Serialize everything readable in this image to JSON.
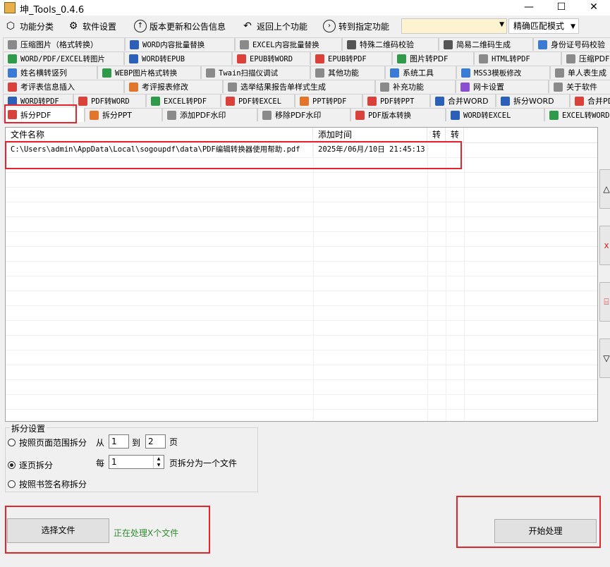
{
  "window": {
    "title": "坤_Tools_0.4.6",
    "minimize": "—",
    "maximize": "☐",
    "close": "✕"
  },
  "toolbar": {
    "categories": "功能分类",
    "settings": "软件设置",
    "updates": "版本更新和公告信息",
    "back": "返回上个功能",
    "goto": "转到指定功能",
    "mode": "精确匹配模式"
  },
  "tab_rows": [
    [
      {
        "label": "压缩图片（格式转换）",
        "icon": "gray"
      },
      {
        "label": "WORD内容批量替换",
        "icon": "word"
      },
      {
        "label": "EXCEL内容批量替换",
        "icon": "gray"
      },
      {
        "label": "特殊二维码校验",
        "icon": "qr"
      },
      {
        "label": "简易二维码生成",
        "icon": "qr"
      },
      {
        "label": "身份证号码校验",
        "icon": "blue"
      }
    ],
    [
      {
        "label": "WORD/PDF/EXCEL转图片",
        "icon": "green"
      },
      {
        "label": "WORD转EPUB",
        "icon": "word"
      },
      {
        "label": "EPUB转WORD",
        "icon": "pdf"
      },
      {
        "label": "EPUB转PDF",
        "icon": "pdf"
      },
      {
        "label": "图片转PDF",
        "icon": "green"
      },
      {
        "label": "HTML转PDF",
        "icon": "gray"
      },
      {
        "label": "压缩PDF",
        "icon": "gray"
      }
    ],
    [
      {
        "label": "姓名横转竖列",
        "icon": "blue"
      },
      {
        "label": "WEBP图片格式转换",
        "icon": "green"
      },
      {
        "label": "Twain扫描仪调试",
        "icon": "gray"
      },
      {
        "label": "其他功能",
        "icon": "gray"
      },
      {
        "label": "系统工具",
        "icon": "blue"
      },
      {
        "label": "MSS3模板修改",
        "icon": "blue"
      },
      {
        "label": "单人表生成",
        "icon": "gray"
      }
    ],
    [
      {
        "label": "考评表信息插入",
        "icon": "pdf"
      },
      {
        "label": "考评报表修改",
        "icon": "orange"
      },
      {
        "label": "选举结果报告单样式生成",
        "icon": "gray"
      },
      {
        "label": "补充功能",
        "icon": "gray"
      },
      {
        "label": "网卡设置",
        "icon": "purple"
      },
      {
        "label": "关于软件",
        "icon": "gray"
      }
    ],
    [
      {
        "label": "WORD转PDF",
        "icon": "word"
      },
      {
        "label": "PDF转WORD",
        "icon": "pdf"
      },
      {
        "label": "EXCEL转PDF",
        "icon": "green"
      },
      {
        "label": "PDF转EXCEL",
        "icon": "pdf"
      },
      {
        "label": "PPT转PDF",
        "icon": "orange"
      },
      {
        "label": "PDF转PPT",
        "icon": "pdf"
      },
      {
        "label": "合并WORD",
        "icon": "word"
      },
      {
        "label": "拆分WORD",
        "icon": "word"
      },
      {
        "label": "合并PDF",
        "icon": "pdf"
      }
    ],
    [
      {
        "label": "拆分PDF",
        "icon": "pdf",
        "active": true
      },
      {
        "label": "拆分PPT",
        "icon": "orange"
      },
      {
        "label": "添加PDF水印",
        "icon": "gray"
      },
      {
        "label": "移除PDF水印",
        "icon": "gray"
      },
      {
        "label": "PDF版本转换",
        "icon": "pdf"
      },
      {
        "label": "WORD转EXCEL",
        "icon": "word"
      },
      {
        "label": "EXCEL转WORD",
        "icon": "green"
      }
    ]
  ],
  "list": {
    "headers": [
      "文件名称",
      "添加时间",
      "转",
      "转"
    ],
    "rows": [
      {
        "name": "C:\\Users\\admin\\AppData\\Local\\sogoupdf\\data\\PDF编辑转换器使用帮助.pdf",
        "time": "2025年/06月/10日 21:45:13"
      }
    ]
  },
  "side_buttons": [
    "△",
    "x",
    "⌸",
    "▽"
  ],
  "split": {
    "group_title": "拆分设置",
    "option_range": "按照页面范围拆分",
    "from_label": "从",
    "from_value": "1",
    "to_label": "到",
    "to_value": "2",
    "page_label": "页",
    "option_each": "逐页拆分",
    "each_label": "每",
    "each_value": "1",
    "each_suffix": "页拆分为一个文件",
    "option_bookmark": "按照书签名称拆分"
  },
  "bottom": {
    "select_files": "选择文件",
    "status": "正在处理X个文件",
    "start": "开始处理"
  },
  "colors": {
    "highlight_box": "#e3262d",
    "status_text": "#2e8b2e"
  }
}
